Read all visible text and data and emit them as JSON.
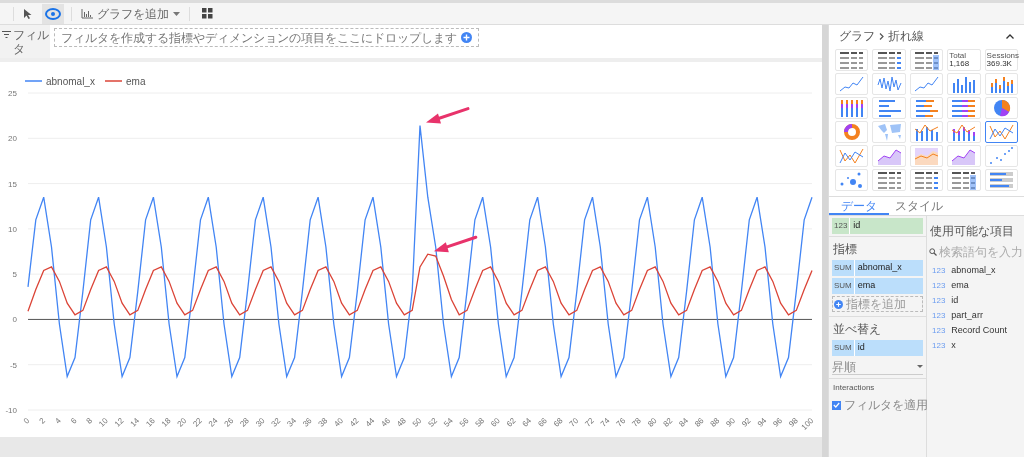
{
  "toolbar": {
    "tools": [
      {
        "kind": "pointer",
        "selected": false
      },
      {
        "kind": "view",
        "selected": true
      }
    ],
    "add_chart": "グラフを追加"
  },
  "filter_bar": {
    "label": "フィルタ",
    "dropzone": "フィルタを作成する指標やディメンションの項目をここにドロップします"
  },
  "chart": {
    "arrows": [
      {
        "kind": "peak"
      },
      {
        "kind": "peak"
      }
    ],
    "chart_data": {
      "type": "line",
      "grid": true,
      "legend": true,
      "x": [
        0,
        1,
        2,
        3,
        4,
        5,
        6,
        7,
        8,
        9,
        10,
        11,
        12,
        13,
        14,
        15,
        16,
        17,
        18,
        19,
        20,
        21,
        22,
        23,
        24,
        25,
        26,
        27,
        28,
        29,
        30,
        31,
        32,
        33,
        34,
        35,
        36,
        37,
        38,
        39,
        40,
        41,
        42,
        43,
        44,
        45,
        46,
        47,
        48,
        49,
        50,
        51,
        52,
        53,
        54,
        55,
        56,
        57,
        58,
        59,
        60,
        61,
        62,
        63,
        64,
        65,
        66,
        67,
        68,
        69,
        70,
        71,
        72,
        73,
        74,
        75,
        76,
        77,
        78,
        79,
        80,
        81,
        82,
        83,
        84,
        85,
        86,
        87,
        88,
        89,
        90,
        91,
        92,
        93,
        94,
        95,
        96,
        97,
        98,
        99,
        100
      ],
      "series": [
        {
          "name": "abnomal_x",
          "color": "#4285f4",
          "values": [
            3.6,
            11,
            13.5,
            8,
            -0.5,
            -6.3,
            -4.2,
            3.1,
            11,
            13.5,
            8,
            -0.5,
            -6.3,
            -4.2,
            3.1,
            11,
            13.5,
            8,
            -0.5,
            -6.3,
            -4.2,
            3.1,
            11,
            13.5,
            8,
            -0.5,
            -6.3,
            -4.2,
            3.1,
            11,
            13.5,
            8,
            -0.5,
            -6.3,
            -4.2,
            3.1,
            11,
            13.5,
            8,
            -0.5,
            -6.3,
            -4.2,
            3.1,
            11,
            13.5,
            8,
            -0.5,
            -6.3,
            -4.2,
            3.1,
            21.4,
            13.5,
            8,
            -0.5,
            -6.3,
            -4.2,
            3.1,
            11,
            13.5,
            8,
            -0.5,
            -6.3,
            -4.2,
            3.1,
            11,
            13.5,
            8,
            -0.5,
            -6.3,
            -4.2,
            3.1,
            11,
            13.5,
            8,
            -0.5,
            -6.3,
            -4.2,
            3.1,
            11,
            13.5,
            8,
            -0.5,
            -6.3,
            -4.2,
            3.1,
            11,
            13.5,
            8,
            -0.5,
            -6.3,
            -4.2,
            3.1,
            11,
            13.5,
            8,
            -0.5,
            -6.3,
            -4.2,
            3.1,
            11,
            13.5
          ]
        },
        {
          "name": "ema",
          "color": "#db4437",
          "values": [
            0.9,
            3.3,
            5.4,
            5.8,
            4.2,
            1.8,
            0.5,
            1,
            3.3,
            5.4,
            5.8,
            4.2,
            1.8,
            0.5,
            1,
            3.3,
            5.4,
            5.8,
            4.2,
            1.8,
            0.5,
            1,
            3.3,
            5.4,
            5.8,
            4.2,
            1.8,
            0.5,
            1,
            3.3,
            5.4,
            5.8,
            4.2,
            1.8,
            0.5,
            1,
            3.3,
            5.4,
            5.8,
            4.2,
            1.8,
            0.5,
            1,
            3.3,
            5.4,
            5.8,
            4.2,
            1.8,
            0.5,
            1,
            5.8,
            7.2,
            7,
            4.8,
            2.2,
            0.5,
            1,
            3.3,
            5.4,
            5.8,
            4.2,
            1.8,
            0.5,
            1,
            3.3,
            5.4,
            5.8,
            4.2,
            1.8,
            0.5,
            1,
            3.3,
            5.4,
            5.8,
            4.2,
            1.8,
            0.5,
            1,
            3.3,
            5.4,
            5.8,
            4.2,
            1.8,
            0.5,
            1,
            3.3,
            5.4,
            5.8,
            4.2,
            1.8,
            0.5,
            1,
            3.3,
            5.4,
            5.8,
            4.2,
            1.8,
            0.5,
            1,
            3.3,
            5.4
          ]
        }
      ],
      "xlim": [
        0,
        100
      ],
      "ylim": [
        -10,
        25
      ],
      "xticks": [
        0,
        2,
        4,
        6,
        8,
        10,
        12,
        14,
        16,
        18,
        20,
        22,
        24,
        26,
        28,
        30,
        32,
        34,
        36,
        38,
        40,
        42,
        44,
        46,
        48,
        50,
        52,
        54,
        56,
        58,
        60,
        62,
        64,
        66,
        68,
        70,
        72,
        74,
        76,
        78,
        80,
        82,
        84,
        86,
        88,
        90,
        92,
        94,
        96,
        98,
        100
      ],
      "yticks": [
        -10,
        -5,
        0,
        5,
        10,
        15,
        20,
        25
      ]
    }
  },
  "panel": {
    "breadcrumb": [
      "グラフ",
      "折れ線"
    ],
    "chart_types": [
      {
        "kind": "table",
        "selected": false
      },
      {
        "kind": "table_bars",
        "selected": false
      },
      {
        "kind": "table_heat",
        "selected": false
      },
      {
        "kind": "scorecard",
        "selected": false,
        "label": "Total",
        "value": "1,168"
      },
      {
        "kind": "scorecard",
        "selected": false,
        "label": "Sessions",
        "value": "369.3K"
      },
      {
        "kind": "line",
        "selected": false
      },
      {
        "kind": "noisy_line",
        "selected": false
      },
      {
        "kind": "line",
        "selected": false
      },
      {
        "kind": "column",
        "selected": false
      },
      {
        "kind": "stacked_column",
        "selected": false
      },
      {
        "kind": "full_column",
        "selected": false
      },
      {
        "kind": "bar",
        "selected": false
      },
      {
        "kind": "stacked_bar",
        "selected": false
      },
      {
        "kind": "full_bar",
        "selected": false
      },
      {
        "kind": "pie",
        "selected": false
      },
      {
        "kind": "donut",
        "selected": false
      },
      {
        "kind": "map",
        "selected": false
      },
      {
        "kind": "combo",
        "selected": false
      },
      {
        "kind": "stacked_combo",
        "selected": false
      },
      {
        "kind": "dual_line",
        "selected": true
      },
      {
        "kind": "dual_line",
        "selected": false
      },
      {
        "kind": "area",
        "selected": false
      },
      {
        "kind": "full_area",
        "selected": false
      },
      {
        "kind": "area",
        "selected": false
      },
      {
        "kind": "scatter",
        "selected": false
      },
      {
        "kind": "bubble",
        "selected": false
      },
      {
        "kind": "table",
        "selected": false
      },
      {
        "kind": "table_bars",
        "selected": false
      },
      {
        "kind": "table_heat",
        "selected": false
      },
      {
        "kind": "bullet",
        "selected": false
      }
    ],
    "tabs": [
      {
        "label": "データ",
        "selected": true
      },
      {
        "label": "スタイル",
        "selected": false
      }
    ],
    "dimension": {
      "type": "123",
      "name": "id"
    },
    "metrics": {
      "title": "指標",
      "items": [
        {
          "agg": "SUM",
          "name": "abnomal_x"
        },
        {
          "agg": "SUM",
          "name": "ema"
        }
      ],
      "add": "指標を追加"
    },
    "sort": {
      "title": "並べ替え",
      "item": {
        "agg": "SUM",
        "name": "id"
      },
      "order": "昇順"
    },
    "interactions": {
      "title": "Interactions",
      "filter": {
        "label": "フィルタを適用",
        "checked": true
      }
    },
    "available": {
      "title": "使用可能な項目",
      "search_placeholder": "検索語句を入力",
      "fields": [
        {
          "type": "123",
          "name": "abnomal_x"
        },
        {
          "type": "123",
          "name": "ema"
        },
        {
          "type": "123",
          "name": "id"
        },
        {
          "type": "123",
          "name": "part_arr"
        },
        {
          "type": "123",
          "name": "Record Count"
        },
        {
          "type": "123",
          "name": "x"
        }
      ]
    }
  }
}
